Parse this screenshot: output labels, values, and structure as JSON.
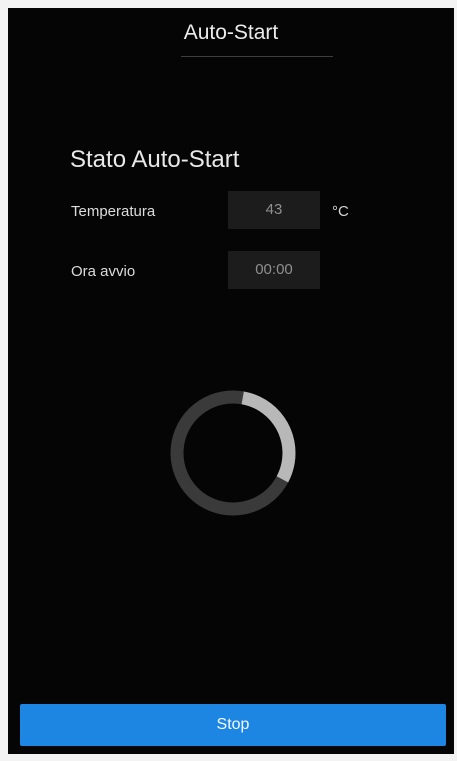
{
  "header": {
    "title": "Auto-Start"
  },
  "status": {
    "title": "Stato Auto-Start",
    "temperature": {
      "label": "Temperatura",
      "value": "43",
      "unit": "°C"
    },
    "start_time": {
      "label": "Ora avvio",
      "value": "00:00"
    }
  },
  "spinner": {
    "progress_fraction": 0.3
  },
  "actions": {
    "stop_label": "Stop"
  },
  "colors": {
    "background": "#050505",
    "button": "#1d86e2",
    "spinner_track": "#3a3a3a",
    "spinner_fill": "#b8b8b8"
  }
}
